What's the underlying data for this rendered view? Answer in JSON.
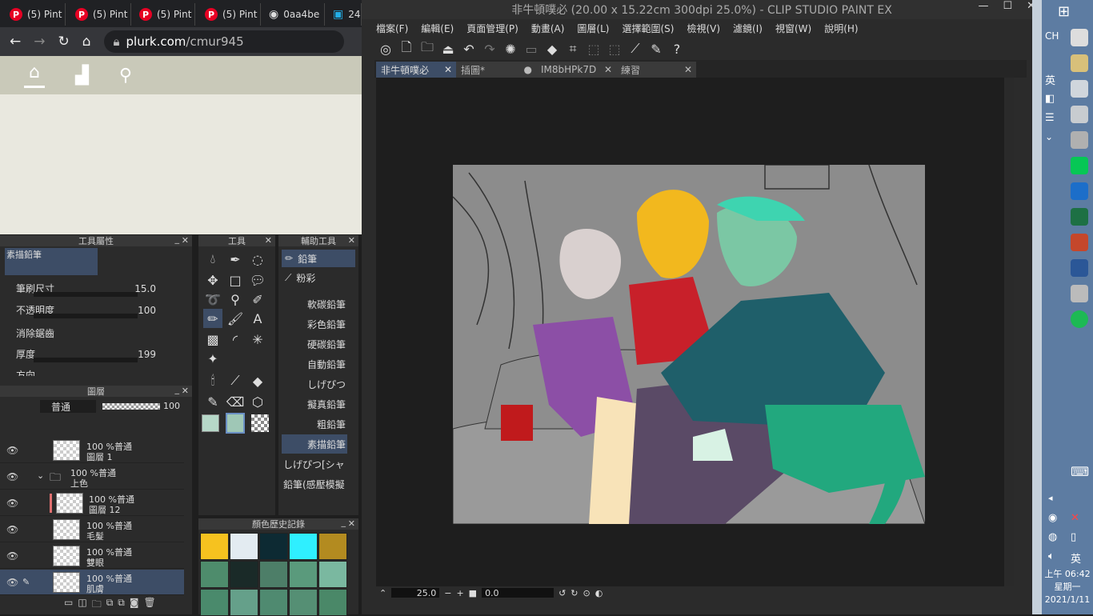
{
  "browser": {
    "tabs": [
      {
        "label": "(5) Pint",
        "icon": "pinterest-icon"
      },
      {
        "label": "(5) Pint",
        "icon": "pinterest-icon"
      },
      {
        "label": "(5) Pint",
        "icon": "pinterest-icon"
      },
      {
        "label": "(5) Pint",
        "icon": "pinterest-icon"
      },
      {
        "label": "0aa4be",
        "icon": "globe-icon"
      },
      {
        "label": "24",
        "icon": "bilibili-icon"
      }
    ],
    "url_host": "plurk.com",
    "url_path": "/cmur945"
  },
  "csp": {
    "title": "非牛頓噗必 (20.00 x 15.22cm 300dpi 25.0%)  - CLIP STUDIO PAINT EX",
    "menu": [
      "檔案(F)",
      "編輯(E)",
      "頁面管理(P)",
      "動畫(A)",
      "圖層(L)",
      "選擇範圍(S)",
      "檢視(V)",
      "濾鏡(I)",
      "視窗(W)",
      "說明(H)"
    ],
    "doc_tabs": [
      {
        "label": "非牛頓噗必",
        "close": "✕"
      },
      {
        "label": "插圖*",
        "close": "●"
      },
      {
        "label": "IM8bHPk7D",
        "close": "✕"
      },
      {
        "label": "練習",
        "close": "✕"
      }
    ],
    "zoom": "25.0",
    "rotation": "0.0"
  },
  "tool_property": {
    "title": "工具屬性",
    "preset": "素描鉛筆",
    "brush_size_label": "筆刷尺寸",
    "brush_size": "15.0",
    "opacity_label": "不透明度",
    "opacity": "100",
    "antialias_label": "消除鋸齒",
    "thickness_label": "厚度",
    "thickness": "199",
    "direction_label": "方向"
  },
  "tools_panel": {
    "title": "工具"
  },
  "sub_tool": {
    "title": "輔助工具",
    "groups": [
      "鉛筆",
      "粉彩"
    ],
    "brushes": [
      "軟碳鉛筆",
      "彩色鉛筆",
      "硬碳鉛筆",
      "自動鉛筆",
      "しげぴつ",
      "擬真鉛筆",
      "粗鉛筆",
      "素描鉛筆",
      "しげぴつ[シャ",
      "鉛筆(感壓模擬"
    ]
  },
  "layers": {
    "title": "圖層",
    "blend_mode": "普通",
    "opacity": "100",
    "rows": [
      {
        "info": "100 %普通",
        "name": "圖層 1"
      },
      {
        "info": "100 %普通",
        "name": "上色"
      },
      {
        "info": "100 %普通",
        "name": "圖層 12"
      },
      {
        "info": "100 %普通",
        "name": "毛髮"
      },
      {
        "info": "100 %普通",
        "name": "雙眼"
      },
      {
        "info": "100 %普通",
        "name": "肌膚"
      }
    ]
  },
  "color_history": {
    "title": "顏色歷史記錄",
    "swatches": [
      "#f6c21f",
      "#e3ebf1",
      "#0d2a33",
      "#2fefff",
      "#b38b20",
      "#4e8c6c",
      "#1a2a28",
      "#4d7e68",
      "#5a9a7c",
      "#7ab8a0",
      "#4a8a6c",
      "#65a08a",
      "#4f8a70",
      "#558f74",
      "#4a8868"
    ]
  },
  "taskbar": {
    "lang1": "CH",
    "lang2": "英",
    "time": "上午 06:42",
    "weekday": "星期一",
    "date": "2021/1/11"
  }
}
